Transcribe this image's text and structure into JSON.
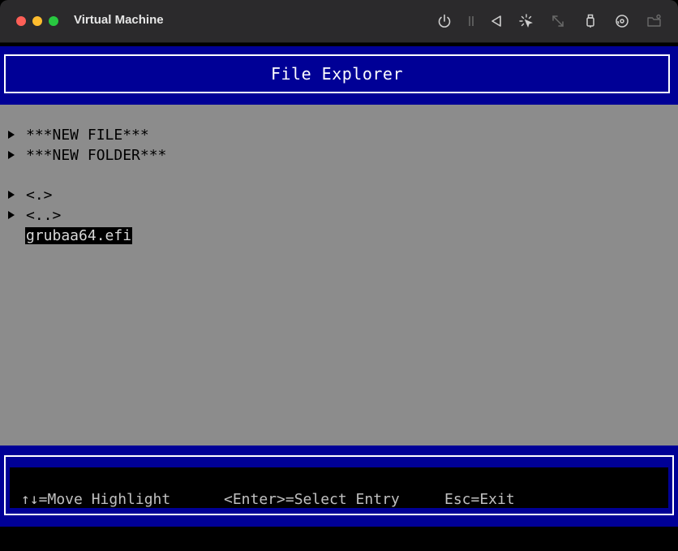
{
  "window": {
    "title": "Virtual Machine"
  },
  "toolbar": {
    "icons": [
      "power-icon",
      "pause-icon",
      "back-icon",
      "capture-cursor-icon",
      "resize-icon",
      "usb-icon",
      "disk-icon",
      "shared-folder-icon"
    ]
  },
  "file_explorer": {
    "title": "File Explorer",
    "entries": [
      {
        "label": "***NEW FILE***",
        "arrow": true,
        "selected": false
      },
      {
        "label": "***NEW FOLDER***",
        "arrow": true,
        "selected": false
      },
      {
        "label": "<.>",
        "arrow": true,
        "selected": false
      },
      {
        "label": "<..>",
        "arrow": true,
        "selected": false
      },
      {
        "label": "grubaa64.efi",
        "arrow": false,
        "selected": true
      }
    ],
    "help": {
      "move": "↑↓=Move Highlight",
      "select": "<Enter>=Select Entry",
      "exit": "Esc=Exit"
    }
  },
  "colors": {
    "header_blue": "#000096",
    "body_gray": "#8c8c8c",
    "titlebar": "#2b2a2c"
  }
}
